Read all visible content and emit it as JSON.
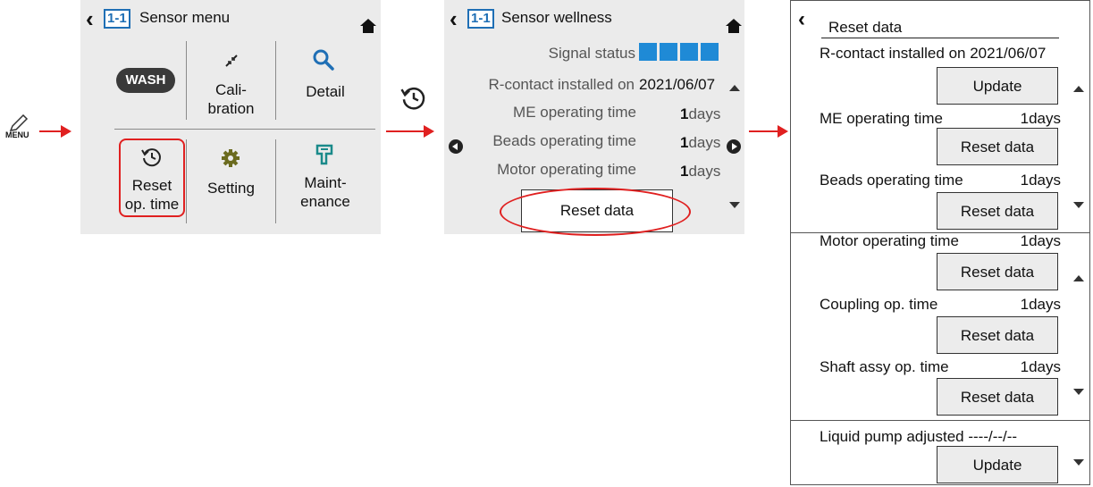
{
  "menu_label": "MENU",
  "colors": {
    "accent_blue": "#1f6fb5",
    "highlight_red": "#e02020",
    "gear_olive": "#6b6b1f",
    "maint_teal": "#1a8a8a"
  },
  "screen1": {
    "badge": "1-1",
    "title": "Sensor menu",
    "wash": "WASH",
    "calibration": [
      "Cali-",
      "bration"
    ],
    "detail": "Detail",
    "reset_op_time": [
      "Reset",
      "op. time"
    ],
    "setting": "Setting",
    "maintenance": [
      "Maint-",
      "enance"
    ]
  },
  "screen2": {
    "badge": "1-1",
    "title": "Sensor wellness",
    "signal_label": "Signal status",
    "signal_bars": 4,
    "r_contact_label": "R-contact installed on",
    "r_contact_date": "2021/06/07",
    "rows": [
      {
        "label": "ME operating time",
        "value": "1",
        "unit": "days"
      },
      {
        "label": "Beads operating time",
        "value": "1",
        "unit": "days"
      },
      {
        "label": "Motor operating time",
        "value": "1",
        "unit": "days"
      }
    ],
    "reset_button": "Reset data"
  },
  "screen3": {
    "title": "Reset data",
    "r_contact": "R-contact installed on 2021/06/07",
    "update": "Update",
    "items": [
      {
        "label": "ME operating time",
        "value": "1days",
        "button": "Reset data"
      },
      {
        "label": "Beads operating time",
        "value": "1days",
        "button": "Reset data"
      },
      {
        "label": "Motor operating time",
        "value": "1days",
        "button": "Reset data"
      },
      {
        "label": "Coupling op. time",
        "value": "1days",
        "button": "Reset data"
      },
      {
        "label": "Shaft assy op. time",
        "value": "1days",
        "button": "Reset data"
      }
    ],
    "liquid_pump": "Liquid pump adjusted ----/--/--",
    "update2": "Update"
  }
}
